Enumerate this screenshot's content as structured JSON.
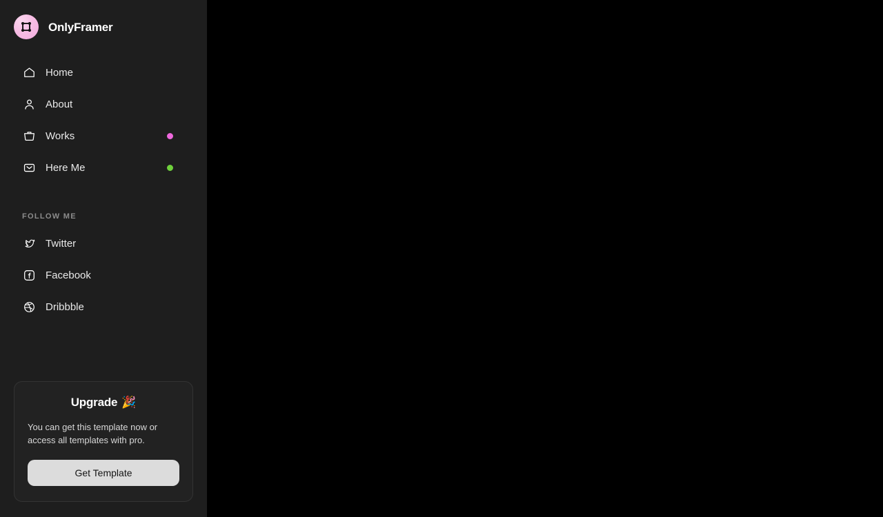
{
  "brand": {
    "name": "OnlyFramer",
    "logo_icon": "framer-frame-icon",
    "logo_colors": {
      "circle": "#f7bde4",
      "mark": "#111111"
    }
  },
  "sidebar": {
    "background": "#1e1e1e",
    "nav": [
      {
        "label": "Home",
        "icon": "home-icon",
        "dot": null,
        "dot_color": null
      },
      {
        "label": "About",
        "icon": "user-icon",
        "dot": null,
        "dot_color": null
      },
      {
        "label": "Works",
        "icon": "briefcase-icon",
        "dot": "pink",
        "dot_color": "#ee68dd"
      },
      {
        "label": "Here Me",
        "icon": "mail-icon",
        "dot": "green",
        "dot_color": "#6fd13c"
      }
    ],
    "follow_section": {
      "label": "FOLLOW ME",
      "items": [
        {
          "label": "Twitter",
          "icon": "twitter-icon"
        },
        {
          "label": "Facebook",
          "icon": "facebook-icon"
        },
        {
          "label": "Dribbble",
          "icon": "dribbble-icon"
        }
      ]
    },
    "upgrade_card": {
      "title": "Upgrade",
      "title_emoji": "🎉",
      "description": "You can get this template now or access all templates with pro.",
      "button_label": "Get Template",
      "button_color": "#dcdcdc"
    }
  },
  "main": {
    "background": "#000000"
  }
}
